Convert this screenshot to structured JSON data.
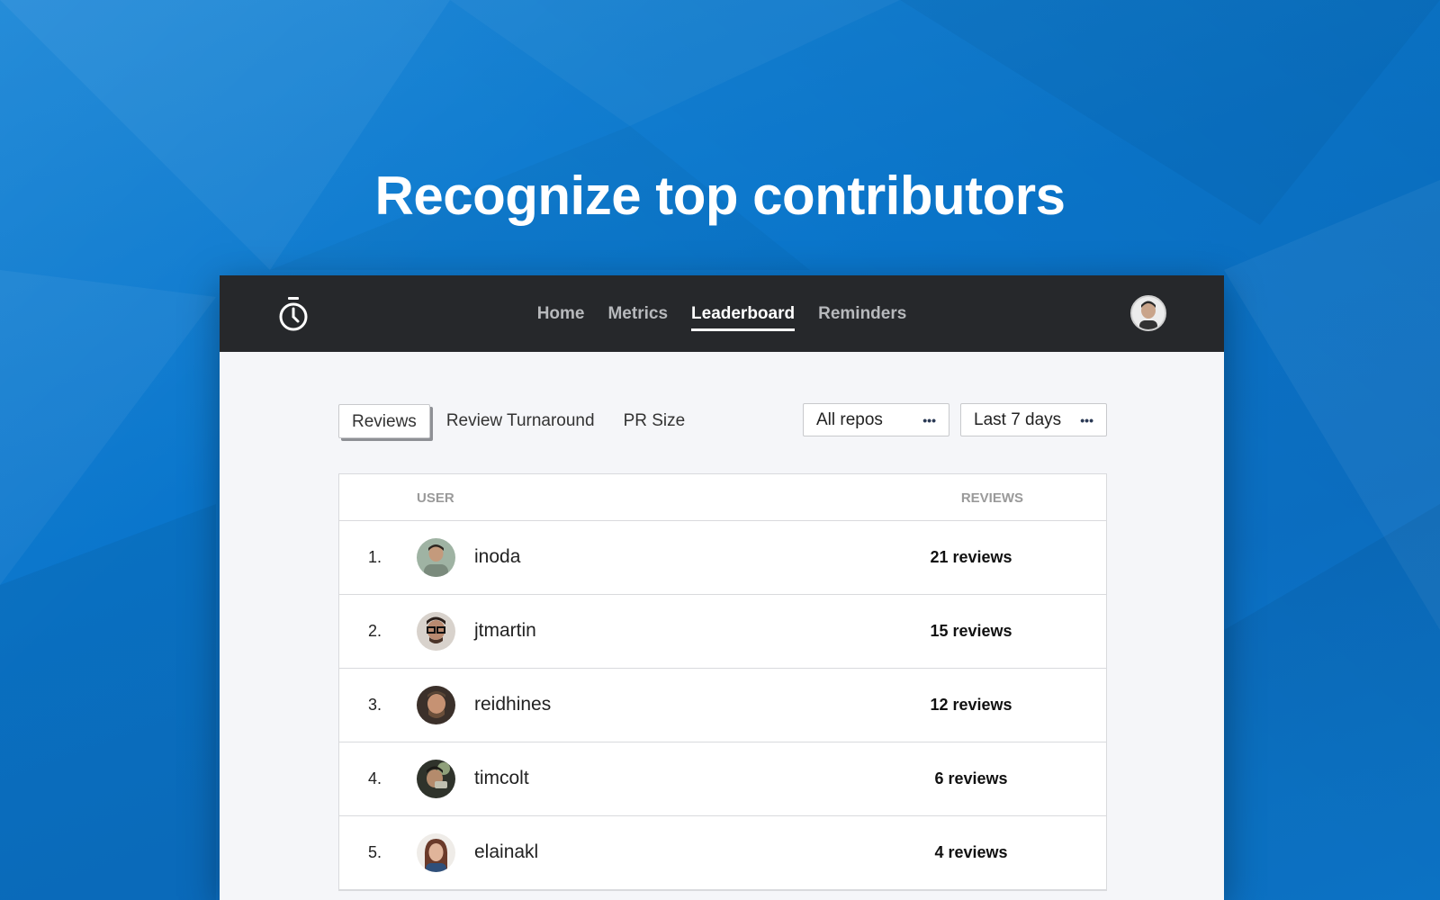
{
  "hero": {
    "title": "Recognize top contributors"
  },
  "nav": {
    "items": [
      {
        "label": "Home",
        "active": false
      },
      {
        "label": "Metrics",
        "active": false
      },
      {
        "label": "Leaderboard",
        "active": true
      },
      {
        "label": "Reminders",
        "active": false
      }
    ]
  },
  "tabs": [
    {
      "label": "Reviews",
      "active": true
    },
    {
      "label": "Review Turnaround",
      "active": false
    },
    {
      "label": "PR Size",
      "active": false
    }
  ],
  "filters": {
    "repo": {
      "value": "All repos",
      "icon": "ellipsis-icon"
    },
    "range": {
      "value": "Last 7 days",
      "icon": "ellipsis-icon"
    }
  },
  "table": {
    "headers": {
      "user": "USER",
      "reviews": "REVIEWS"
    },
    "rows": [
      {
        "rank": "1.",
        "user": "inoda",
        "reviews": "21 reviews",
        "avatar_color": "#7a8a7c"
      },
      {
        "rank": "2.",
        "user": "jtmartin",
        "reviews": "15 reviews",
        "avatar_color": "#5b4a44"
      },
      {
        "rank": "3.",
        "user": "reidhines",
        "reviews": "12 reviews",
        "avatar_color": "#6b5546"
      },
      {
        "rank": "4.",
        "user": "timcolt",
        "reviews": "6 reviews",
        "avatar_color": "#3b3f36"
      },
      {
        "rank": "5.",
        "user": "elainakl",
        "reviews": "4 reviews",
        "avatar_color": "#6a4a3d"
      }
    ]
  },
  "colors": {
    "background": "#0b76cc",
    "topbar": "#26282b",
    "panel": "#f5f6f9"
  }
}
